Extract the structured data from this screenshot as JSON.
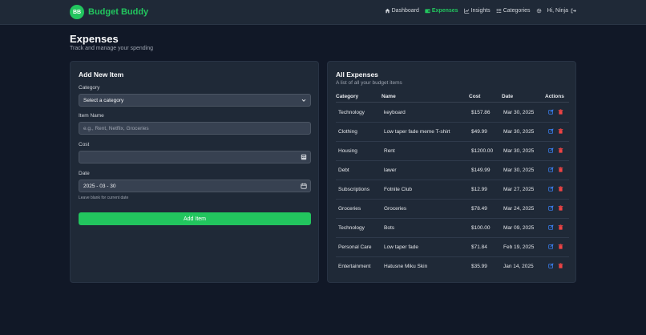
{
  "brand": {
    "logo_text": "BB",
    "name": "Budget Buddy",
    "color": "#22c55e"
  },
  "nav": {
    "links": [
      {
        "label": "Dashboard",
        "icon": "home-icon",
        "active": false
      },
      {
        "label": "Expenses",
        "icon": "wallet-icon",
        "active": true
      },
      {
        "label": "Insights",
        "icon": "chart-icon",
        "active": false
      },
      {
        "label": "Categories",
        "icon": "list-icon",
        "active": false
      }
    ],
    "settings_icon": "gear-icon",
    "greeting": "Hi, Ninja",
    "logout_icon": "logout-icon"
  },
  "page": {
    "title": "Expenses",
    "subtitle": "Track and manage your spending"
  },
  "form": {
    "title": "Add New Item",
    "category_label": "Category",
    "category_value": "Select a category",
    "item_label": "Item Name",
    "item_placeholder": "e.g., Rent, Netflix, Groceries",
    "cost_label": "Cost",
    "cost_value": "",
    "date_label": "Date",
    "date_value": "2025 - 03 - 30",
    "date_hint": "Leave blank for current date",
    "submit_label": "Add Item"
  },
  "table": {
    "title": "All Expenses",
    "subtitle": "A list of all your budget items",
    "headers": {
      "category": "Category",
      "name": "Name",
      "cost": "Cost",
      "date": "Date",
      "actions": "Actions"
    },
    "rows": [
      {
        "category": "Technology",
        "name": "keyboard",
        "cost": "$157.86",
        "date": "Mar 30, 2025"
      },
      {
        "category": "Clothing",
        "name": "Low taper fade meme T-shirt",
        "cost": "$49.99",
        "date": "Mar 30, 2025"
      },
      {
        "category": "Housing",
        "name": "Rent",
        "cost": "$1200.00",
        "date": "Mar 30, 2025"
      },
      {
        "category": "Debt",
        "name": "lawer",
        "cost": "$149.99",
        "date": "Mar 30, 2025"
      },
      {
        "category": "Subscriptions",
        "name": "Fotnite Club",
        "cost": "$12.99",
        "date": "Mar 27, 2025"
      },
      {
        "category": "Groceries",
        "name": "Groceries",
        "cost": "$78.49",
        "date": "Mar 24, 2025"
      },
      {
        "category": "Technology",
        "name": "Bots",
        "cost": "$100.00",
        "date": "Mar 09, 2025"
      },
      {
        "category": "Personal Care",
        "name": "Low taper fade",
        "cost": "$71.84",
        "date": "Feb 19, 2025"
      },
      {
        "category": "Entertainment",
        "name": "Hatusne Miku Skin",
        "cost": "$35.99",
        "date": "Jan 14, 2025"
      }
    ],
    "edit_color": "#3b82f6",
    "delete_color": "#ef4444"
  }
}
